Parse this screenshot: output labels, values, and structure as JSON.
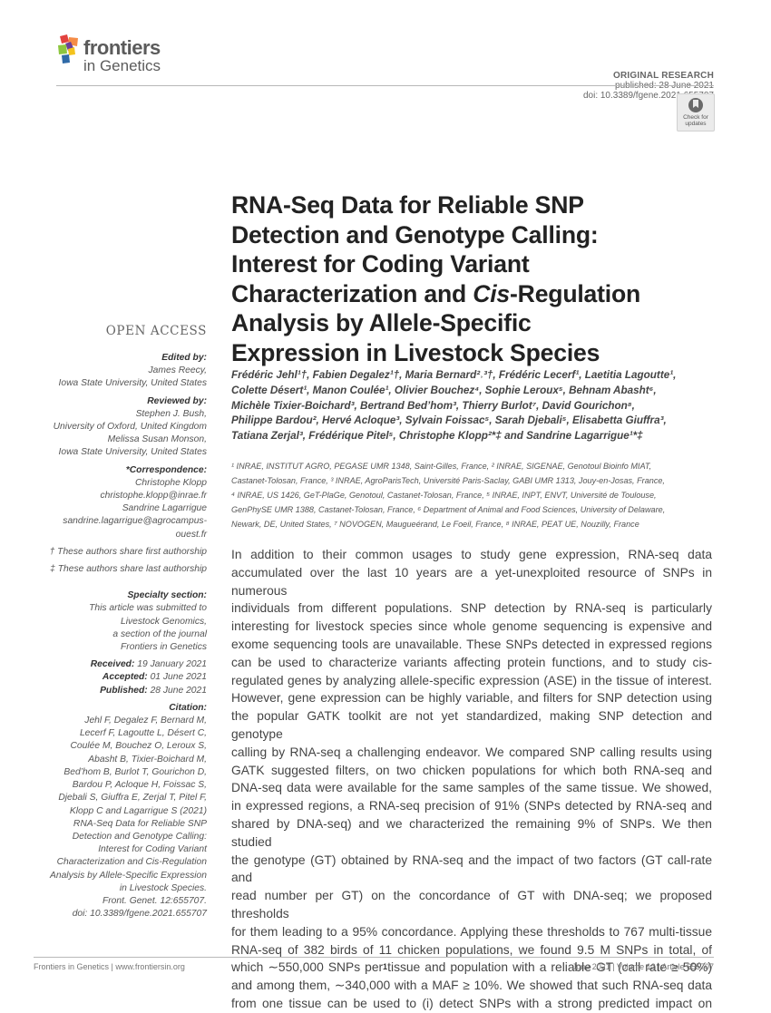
{
  "journal": {
    "brand": "frontiers",
    "name": "in Genetics",
    "logo_colors": [
      "#e2423f",
      "#f58c47",
      "#6a3f99",
      "#8dc63f",
      "#f4c31d",
      "#2f6aa7"
    ]
  },
  "header": {
    "article_type": "ORIGINAL RESEARCH",
    "published": "published: 28 June 2021",
    "doi": "doi: 10.3389/fgene.2021.655707",
    "check_updates": [
      "Check for",
      "updates"
    ]
  },
  "sidebar": {
    "open_access": "OPEN ACCESS",
    "edited_by": {
      "heading": "Edited by:",
      "lines": [
        "James Reecy,",
        "Iowa State University, United States"
      ]
    },
    "reviewed_by": {
      "heading": "Reviewed by:",
      "lines": [
        "Stephen J. Bush,",
        "University of Oxford, United Kingdom",
        "Melissa Susan Monson,",
        "Iowa State University, United States"
      ]
    },
    "correspondence": {
      "heading": "*Correspondence:",
      "lines": [
        "Christophe Klopp",
        "christophe.klopp@inrae.fr",
        "Sandrine Lagarrigue",
        "sandrine.lagarrigue@agrocampus-",
        "ouest.fr"
      ]
    },
    "footnotes": [
      "† These authors share first authorship",
      "‡ These authors share last authorship"
    ],
    "specialty": {
      "heading": "Specialty section:",
      "lines": [
        "This article was submitted to",
        "Livestock Genomics,",
        "a section of the journal",
        "Frontiers in Genetics"
      ]
    },
    "dates": [
      {
        "label": "Received:",
        "value": "19 January 2021"
      },
      {
        "label": "Accepted:",
        "value": "01 June 2021"
      },
      {
        "label": "Published:",
        "value": "28 June 2021"
      }
    ],
    "citation": {
      "heading": "Citation:",
      "lines": [
        "Jehl F, Degalez F, Bernard M,",
        "Lecerf F, Lagoutte L, Désert C,",
        "Coulée M, Bouchez O, Leroux S,",
        "Abasht B, Tixier-Boichard M,",
        "Bed’hom B, Burlot T, Gourichon D,",
        "Bardou P, Acloque H, Foissac S,",
        "Djebali S, Giuffra E, Zerjal T, Pitel F,",
        "Klopp C and Lagarrigue S (2021)",
        "RNA-Seq Data for Reliable SNP",
        "Detection and Genotype Calling:",
        "Interest for Coding Variant",
        "Characterization and Cis-Regulation",
        "Analysis by Allele-Specific Expression",
        "in Livestock Species.",
        "Front. Genet. 12:655707.",
        "doi: 10.3389/fgene.2021.655707"
      ]
    }
  },
  "article": {
    "title_lines": [
      "RNA-Seq Data for Reliable SNP",
      "Detection and Genotype Calling:",
      "Interest for Coding Variant",
      "Characterization and Cis-Regulation",
      "Analysis by Allele-Specific",
      "Expression in Livestock Species"
    ],
    "authors_lines": [
      "Frédéric Jehl¹†, Fabien Degalez¹†, Maria Bernard²˒³†, Frédéric Lecerf¹, Laetitia Lagoutte¹,",
      "Colette Désert¹, Manon Coulée¹, Olivier Bouchez⁴, Sophie Leroux⁵, Behnam Abasht⁶,",
      "Michèle Tixier-Boichard³, Bertrand Bed’hom³, Thierry Burlot⁷, David Gourichon⁸,",
      "Philippe Bardou², Hervé Acloque³, Sylvain Foissac⁵, Sarah Djebali⁵, Elisabetta Giuffra³,",
      "Tatiana Zerjal³, Frédérique Pitel⁵, Christophe Klopp²*‡ and Sandrine Lagarrigue¹*‡"
    ],
    "affiliation_lines": [
      "¹ INRAE, INSTITUT AGRO, PEGASE UMR 1348, Saint-Gilles, France, ² INRAE, SIGENAE, Genotoul Bioinfo MIAT,",
      "Castanet-Tolosan, France, ³ INRAE, AgroParisTech, Université Paris-Saclay, GABI UMR 1313, Jouy-en-Josas, France,",
      "⁴ INRAE, US 1426, GeT-PlaGe, Genotoul, Castanet-Tolosan, France, ⁵ INRAE, INPT, ENVT, Université de Toulouse,",
      "GenPhySE UMR 1388, Castanet-Tolosan, France, ⁶ Department of Animal and Food Sciences, University of Delaware,",
      "Newark, DE, United States, ⁷ NOVOGEN, Maugueérand, Le Foeil, France, ⁸ INRAE, PEAT UE, Nouzilly, France"
    ],
    "abstract_lines": [
      "In addition to their common usages to study gene expression, RNA-seq data",
      "accumulated over the last 10 years are a yet-unexploited resource of SNPs in numerous",
      "individuals from different populations. SNP detection by RNA-seq is particularly",
      "interesting for livestock species since whole genome sequencing is expensive and",
      "exome sequencing tools are unavailable. These SNPs detected in expressed regions",
      "can be used to characterize variants affecting protein functions, and to study cis-",
      "regulated genes by analyzing allele-specific expression (ASE) in the tissue of interest.",
      "However, gene expression can be highly variable, and filters for SNP detection using",
      "the popular GATK toolkit are not yet standardized, making SNP detection and genotype",
      "calling by RNA-seq a challenging endeavor. We compared SNP calling results using",
      "GATK suggested filters, on two chicken populations for which both RNA-seq and",
      "DNA-seq data were available for the same samples of the same tissue. We showed,",
      "in expressed regions, a RNA-seq precision of 91% (SNPs detected by RNA-seq and",
      "shared by DNA-seq) and we characterized the remaining 9% of SNPs. We then studied",
      "the genotype (GT) obtained by RNA-seq and the impact of two factors (GT call-rate and",
      "read number per GT) on the concordance of GT with DNA-seq; we proposed thresholds",
      "for them leading to a 95% concordance. Applying these thresholds to 767 multi-tissue",
      "RNA-seq of 382 birds of 11 chicken populations, we found 9.5 M SNPs in total, of",
      "which ∼550,000 SNPs per tissue and population with a reliable GT (call rate ≥ 50%)",
      "and among them, ∼340,000 with a MAF ≥ 10%. We showed that such RNA-seq data",
      "from one tissue can be used to (i) detect SNPs with a strong predicted impact on"
    ]
  },
  "footer": {
    "left": "Frontiers in Genetics | www.frontiersin.org",
    "page": "1",
    "right": "June 2021 | Volume 12 | Article 655707"
  }
}
